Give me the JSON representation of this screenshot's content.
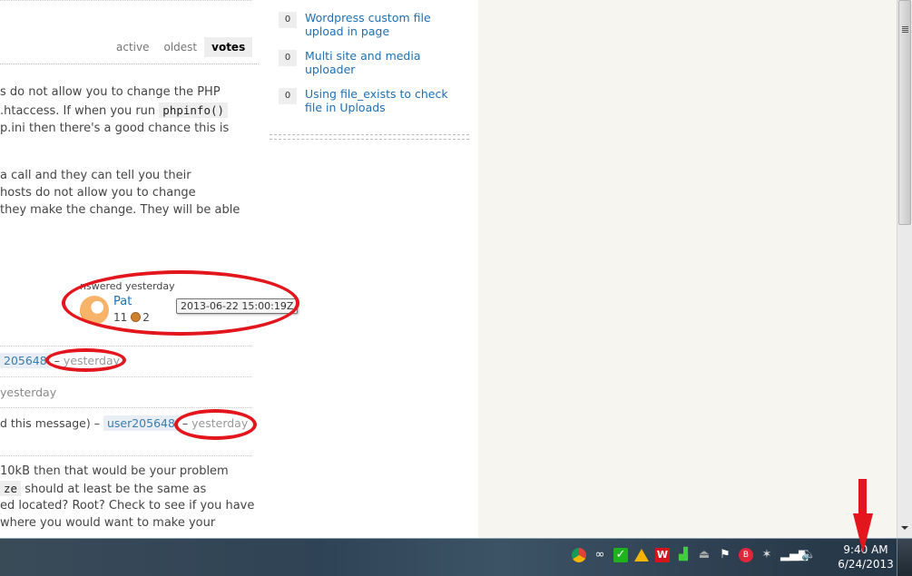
{
  "sort_tabs": [
    {
      "label": "active",
      "active": false
    },
    {
      "label": "oldest",
      "active": false
    },
    {
      "label": "votes",
      "active": true
    }
  ],
  "answer": {
    "para1": [
      {
        "before": "s do not allow you to change the PHP"
      },
      {
        "before": ".htaccess. If when you run ",
        "code": "phpinfo()"
      },
      {
        "before": "p.ini then there's a good chance this is"
      }
    ],
    "para2": [
      "a call and they can tell you their",
      "hosts do not allow you to change",
      " they make the change. They will be able"
    ],
    "answered_label": "nswered yesterday",
    "user_name": "Pat",
    "reputation": "11",
    "bronze_badges": "2",
    "tooltip": "2013-06-22 15:00:19Z"
  },
  "comments": [
    {
      "prefix": "",
      "user": "205648",
      "sep": " – ",
      "date": "yesterday"
    },
    {
      "prefix": "",
      "user": "",
      "sep": "",
      "date": "yesterday"
    },
    {
      "prefix": "d this message) – ",
      "user": "user205648",
      "sep": " – ",
      "date": "yesterday"
    }
  ],
  "answer2": [
    {
      "before": " 10kB then that would be your problem"
    },
    {
      "code": "ze",
      "after": " should at least be the same as"
    },
    {
      "before": "ed located? Root? Check to see if you have"
    },
    {
      "before": " where you would want to make your"
    }
  ],
  "related": [
    {
      "votes": "0",
      "title": "Wordpress custom file upload in page"
    },
    {
      "votes": "0",
      "title": "Multi site and media uploader"
    },
    {
      "votes": "0",
      "title": "Using file_exists to check file in Uploads"
    }
  ],
  "taskbar": {
    "tray_icons": [
      "chrome-icon",
      "creative-cloud-icon",
      "sync-icon",
      "google-drive-icon",
      "app-w-icon",
      "signal-bars-icon",
      "usb-eject-icon",
      "action-center-flag-icon",
      "media-icon",
      "network-tool-icon",
      "network-icon",
      "volume-icon"
    ],
    "time": "9:40 AM",
    "date": "6/24/2013"
  },
  "colors": {
    "link": "#1f6fb2",
    "annotation": "#e3151d"
  }
}
